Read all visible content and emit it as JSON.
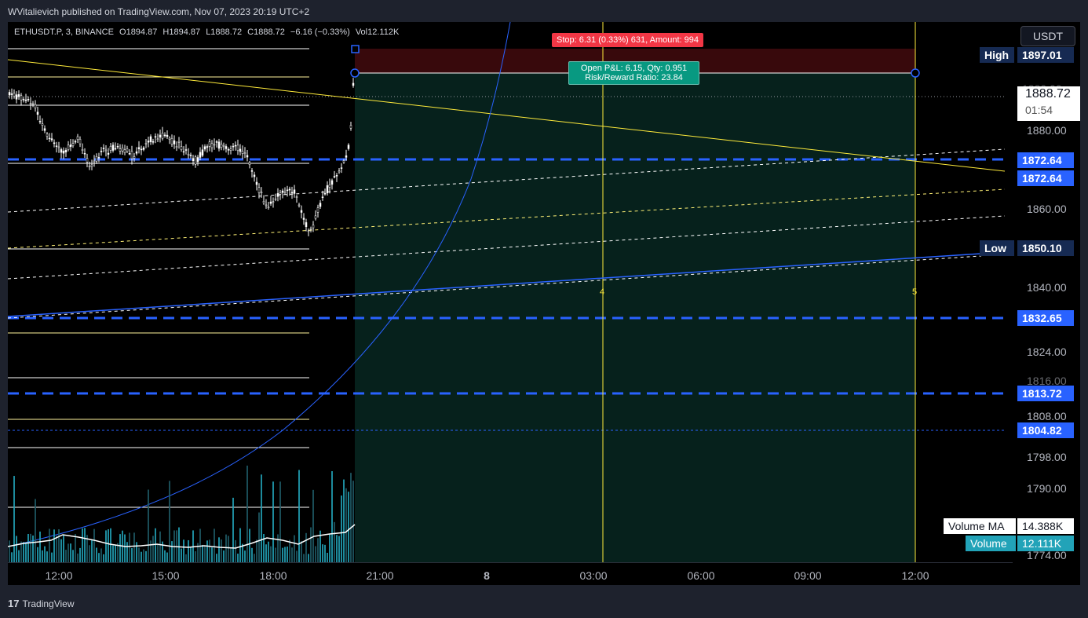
{
  "header": {
    "publisher_line": "WVitalievich published on TradingView.com, Nov 07, 2023 20:19 UTC+2"
  },
  "symbol": {
    "ticker": "ETHUSDT.P, 3, BINANCE",
    "open": "O1894.87",
    "high": "H1894.87",
    "low": "L1888.72",
    "close": "C1888.72",
    "change": "−6.16 (−0.33%)",
    "volume": "Vol12.112K"
  },
  "currency_button": "USDT",
  "price_axis": {
    "ticks": [
      "1880.00",
      "1860.00",
      "1840.00",
      "1824.00",
      "1816.00",
      "1808.00",
      "1798.00",
      "1790.00",
      "1774.00"
    ],
    "current_price": "1888.72",
    "countdown": "01:54",
    "high_label": "High",
    "high_value": "1897.01",
    "low_label": "Low",
    "low_value": "1850.10",
    "level_tags": [
      "1872.64",
      "1872.64",
      "1832.65",
      "1813.72",
      "1804.82"
    ],
    "partial_tick": "1880.00"
  },
  "volume_legend": {
    "ma_label": "Volume MA",
    "ma_value": "14.388K",
    "vol_label": "Volume",
    "vol_value": "12.111K"
  },
  "time_axis": [
    "12:00",
    "15:00",
    "18:00",
    "21:00",
    "8",
    "03:00",
    "06:00",
    "09:00",
    "12:00"
  ],
  "position_tool": {
    "stop_text": "Stop: 6.31 (0.33%) 631, Amount: 994",
    "pnl_line1": "Open P&L: 6.15, Qty: 0.951",
    "pnl_line2": "Risk/Reward Ratio: 23.84"
  },
  "vline_labels": [
    "4",
    "5"
  ],
  "colors": {
    "accent_blue": "#2962ff",
    "stop_red": "#f23645",
    "profit_teal": "#089981",
    "trend_yellow": "#ffeb3b"
  },
  "footer": {
    "brand": "TradingView",
    "mark": "17"
  }
}
